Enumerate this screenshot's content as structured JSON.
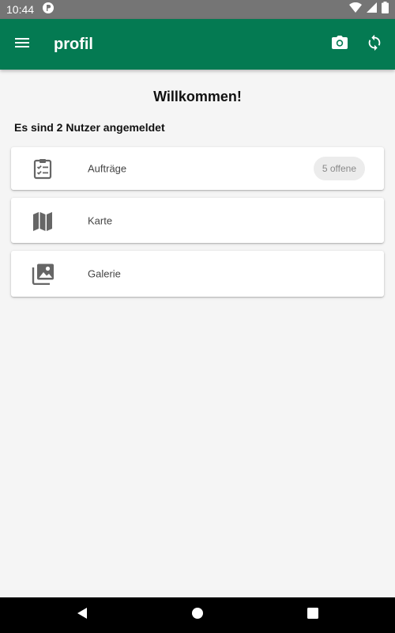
{
  "status_bar": {
    "time": "10:44",
    "left_icons": [
      "notification-app-icon"
    ],
    "right_icons": [
      "wifi-icon",
      "cell-signal-icon",
      "battery-icon"
    ]
  },
  "app_bar": {
    "title": "profil",
    "menu_icon": "menu-icon",
    "actions": [
      "camera-icon",
      "sync-icon"
    ],
    "color": "#047a52"
  },
  "main": {
    "welcome": "Willkommen!",
    "users_logged_in": "Es sind 2 Nutzer angemeldet",
    "cards": [
      {
        "icon": "clipboard-checklist-icon",
        "label": "Aufträge",
        "badge": "5 offene"
      },
      {
        "icon": "map-icon",
        "label": "Karte"
      },
      {
        "icon": "gallery-icon",
        "label": "Galerie"
      }
    ]
  },
  "nav_bar": {
    "buttons": [
      "back-icon",
      "home-icon",
      "recents-icon"
    ]
  }
}
